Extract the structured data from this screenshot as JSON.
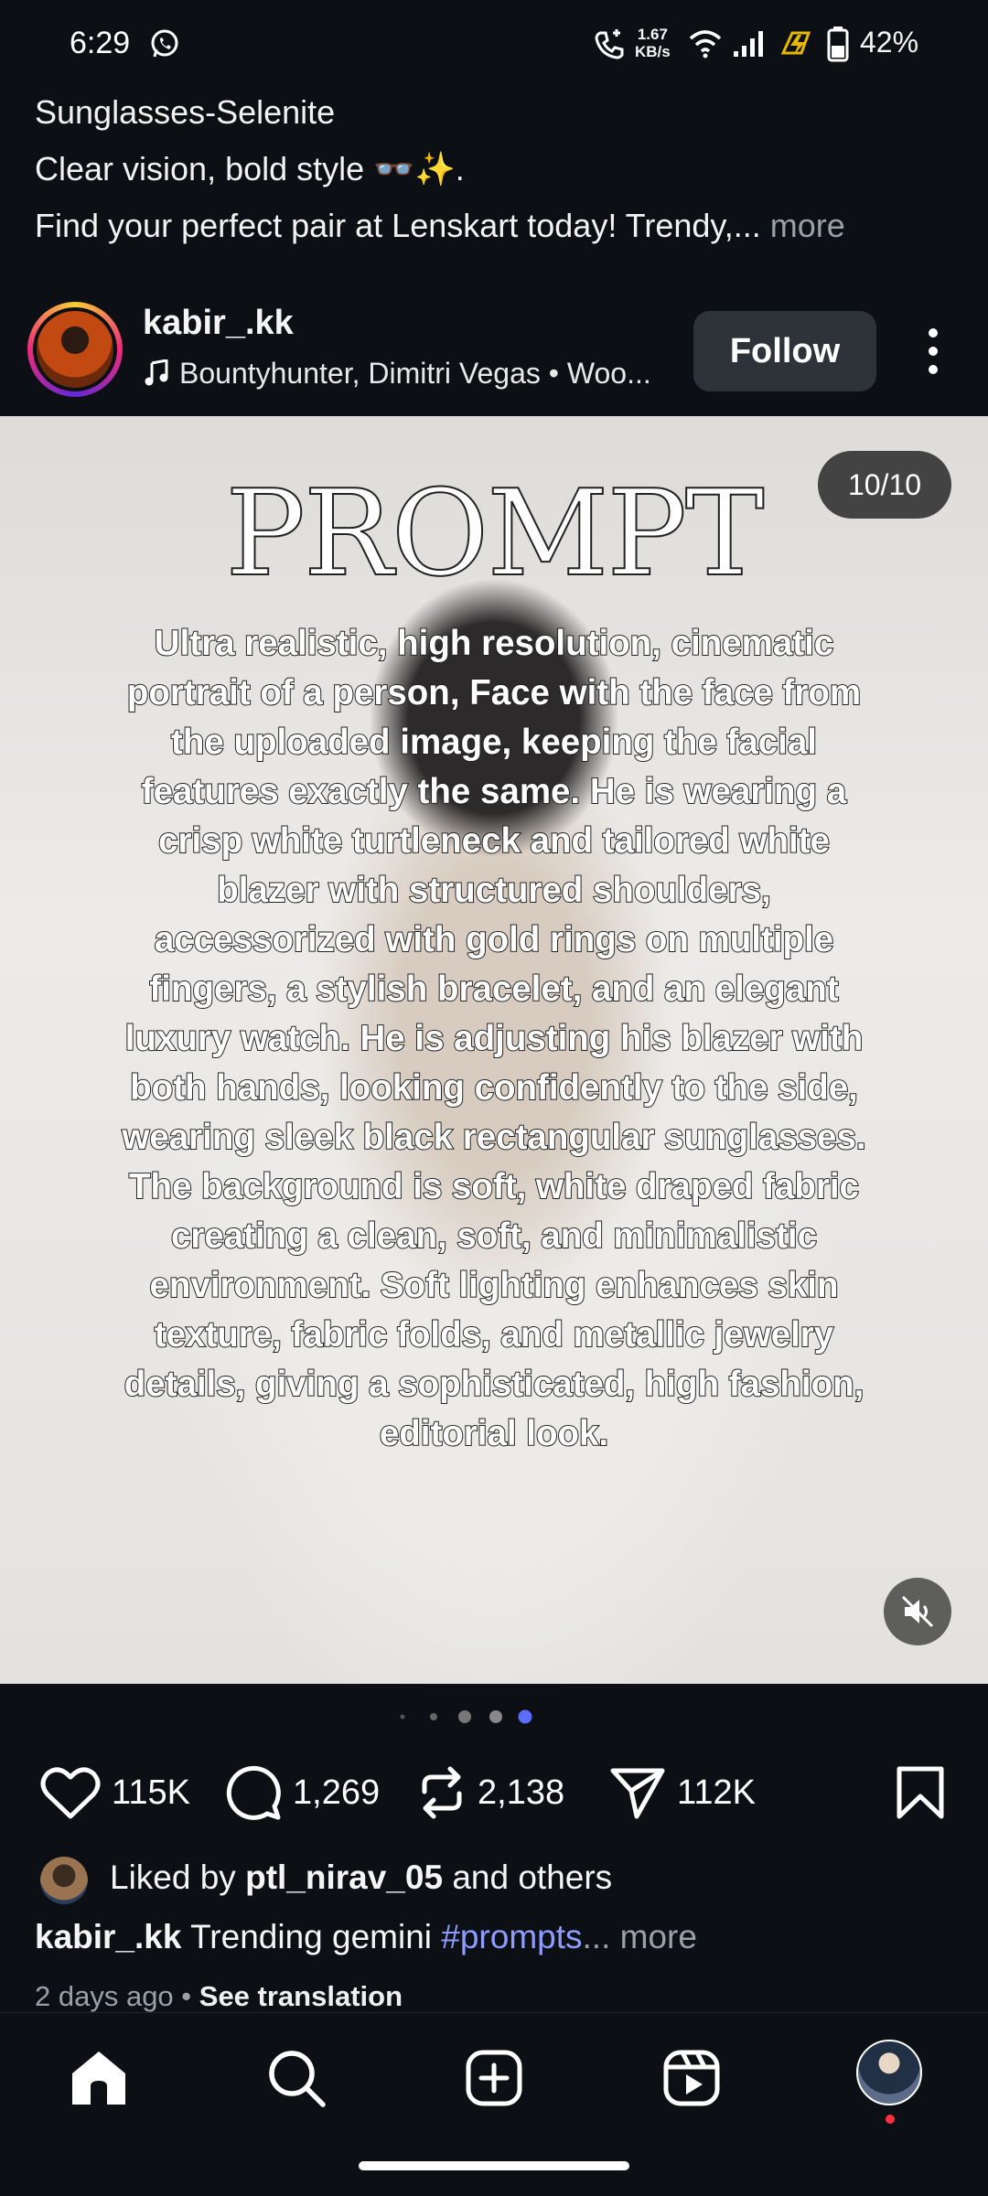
{
  "status_bar": {
    "time": "6:29",
    "net_speed_value": "1.67",
    "net_speed_unit": "KB/s",
    "battery": "42%"
  },
  "post_header": {
    "title": "Sunglasses-Selenite",
    "line2": "Clear vision, bold style 👓✨.",
    "line3": "Find your perfect pair at Lenskart today! Trendy,...",
    "more": " more"
  },
  "author": {
    "username": "kabir_.kk",
    "music": "Bountyhunter, Dimitri Vegas • Woo...",
    "follow_label": "Follow"
  },
  "media": {
    "counter": "10/10",
    "title": "PROMPT",
    "prompt_text": "Ultra realistic, high resolution, cinematic portrait of a person, Face with the face from the uploaded image, keeping the facial features exactly the same. He is wearing a crisp white turtleneck and tailored white blazer with structured shoulders, accessorized with gold rings on multiple fingers, a stylish bracelet, and an elegant luxury watch. He is adjusting his blazer with both hands, looking confidently to the side, wearing sleek black rectangular sunglasses. The background is soft, white draped fabric creating a clean, soft, and minimalistic environment. Soft lighting enhances skin texture, fabric folds, and metallic jewelry details, giving a sophisticated, high fashion, editorial look.",
    "carousel_active_index": 10,
    "carousel_total": 10
  },
  "actions": {
    "likes": "115K",
    "comments": "1,269",
    "reposts": "2,138",
    "shares": "112K"
  },
  "liked_by": {
    "prefix": "Liked by ",
    "user": "ptl_nirav_05",
    "suffix": " and others"
  },
  "caption": {
    "username": "kabir_.kk",
    "text": " Trending gemini ",
    "hashtag": "#prompts",
    "more": "... more"
  },
  "meta": {
    "time_ago": "2 days ago",
    "separator": " • ",
    "see_translation": "See translation"
  },
  "icons": {
    "status": [
      "whatsapp-icon",
      "call-icon",
      "wifi-icon",
      "signal-icon",
      "charging-icon",
      "battery-icon"
    ],
    "actions": [
      "heart-icon",
      "comment-icon",
      "repost-icon",
      "share-icon",
      "bookmark-icon"
    ],
    "nav": [
      "home-icon",
      "search-icon",
      "create-icon",
      "reels-icon",
      "profile-avatar"
    ],
    "accent": "#8f9cff",
    "carousel_dot_active": "#5b6cff"
  }
}
